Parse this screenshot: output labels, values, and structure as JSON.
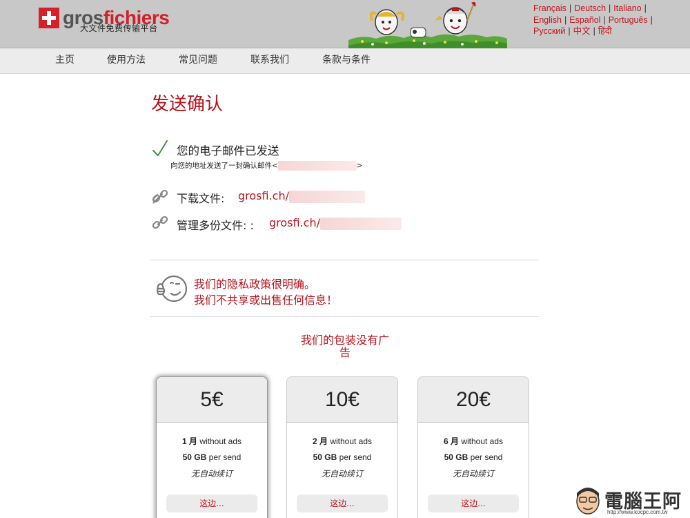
{
  "header": {
    "brand_part1": "gros",
    "brand_part2": "fichiers",
    "tagline": "大文件免费传输平台",
    "languages": {
      "row1": [
        "Français",
        "Deutsch",
        "Italiano"
      ],
      "row2": [
        "English",
        "Español",
        "Português"
      ],
      "row3": [
        "Русский",
        "中文",
        "हिंदी"
      ]
    }
  },
  "nav": {
    "items": [
      "主页",
      "使用方法",
      "常见问题",
      "联系我们",
      "条款与条件"
    ]
  },
  "main": {
    "title": "发送确认",
    "sent_title": "您的电子邮件已发送",
    "sent_sub_prefix": "向您的地址发送了一封确认邮件<",
    "sent_sub_suffix": ">",
    "download_label": "下载文件:",
    "download_link": "grosfi.ch/",
    "manage_label": "管理多份文件: :",
    "manage_link": "grosfi.ch/",
    "privacy_line1": "我们的隐私政策很明确。",
    "privacy_line2": "我们不共享或出售任何信息！",
    "noads_line1": "我们的包装没有广",
    "noads_line2": "告"
  },
  "plans": [
    {
      "price": "5€",
      "months": "1 月",
      "months_suffix": " without ads",
      "data": "50 GB",
      "data_suffix": " per send",
      "renew": "无自动续订",
      "button": "这边..."
    },
    {
      "price": "10€",
      "months": "2 月",
      "months_suffix": " without ads",
      "data": "50 GB",
      "data_suffix": " per send",
      "renew": "无自动续订",
      "button": "这边..."
    },
    {
      "price": "20€",
      "months": "6 月",
      "months_suffix": " without ads",
      "data": "50 GB",
      "data_suffix": " per send",
      "renew": "无自动续订",
      "button": "这边..."
    }
  ],
  "watermark": {
    "text": "電腦王阿達",
    "url": "http://www.kocpc.com.tw"
  },
  "colors": {
    "accent_red": "#c0141c",
    "header_gray": "#c8c8c8",
    "nav_gray": "#ececec"
  }
}
